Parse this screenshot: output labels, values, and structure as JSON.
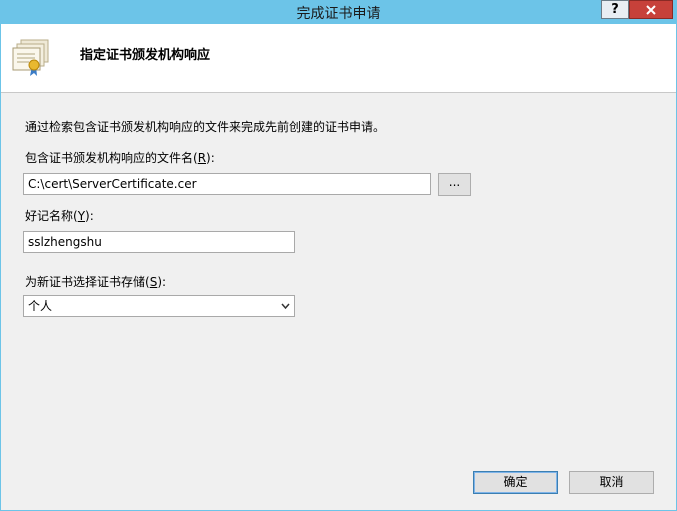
{
  "window": {
    "title": "完成证书申请",
    "help_label": "?"
  },
  "header": {
    "title": "指定证书颁发机构响应"
  },
  "main": {
    "description": "通过检索包含证书颁发机构响应的文件来完成先前创建的证书申请。",
    "file_label_prefix": "包含证书颁发机构响应的文件名(",
    "file_label_key": "R",
    "file_label_suffix": "):",
    "file_value": "C:\\cert\\ServerCertificate.cer",
    "browse_label": "...",
    "name_label_prefix": "好记名称(",
    "name_label_key": "Y",
    "name_label_suffix": "):",
    "name_value": "sslzhengshu",
    "store_label_prefix": "为新证书选择证书存储(",
    "store_label_key": "S",
    "store_label_suffix": "):",
    "store_value": "个人"
  },
  "footer": {
    "ok_label": "确定",
    "cancel_label": "取消"
  },
  "icons": {
    "close": "close-icon",
    "certificate": "certificate-icon",
    "dropdown": "chevron-down-icon"
  }
}
